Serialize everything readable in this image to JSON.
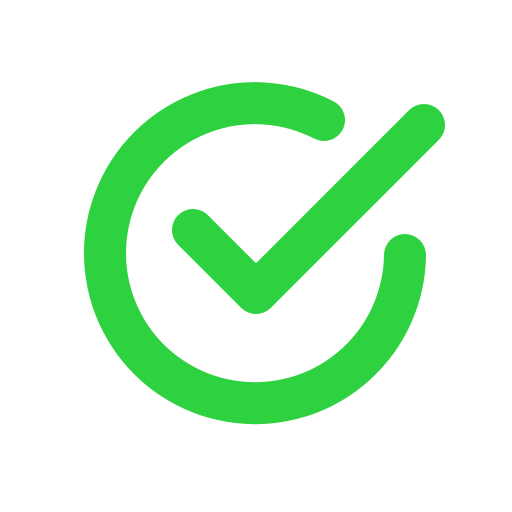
{
  "icon": {
    "name": "check-circle-icon",
    "color": "#2ed13f",
    "background": "#ffffff"
  }
}
